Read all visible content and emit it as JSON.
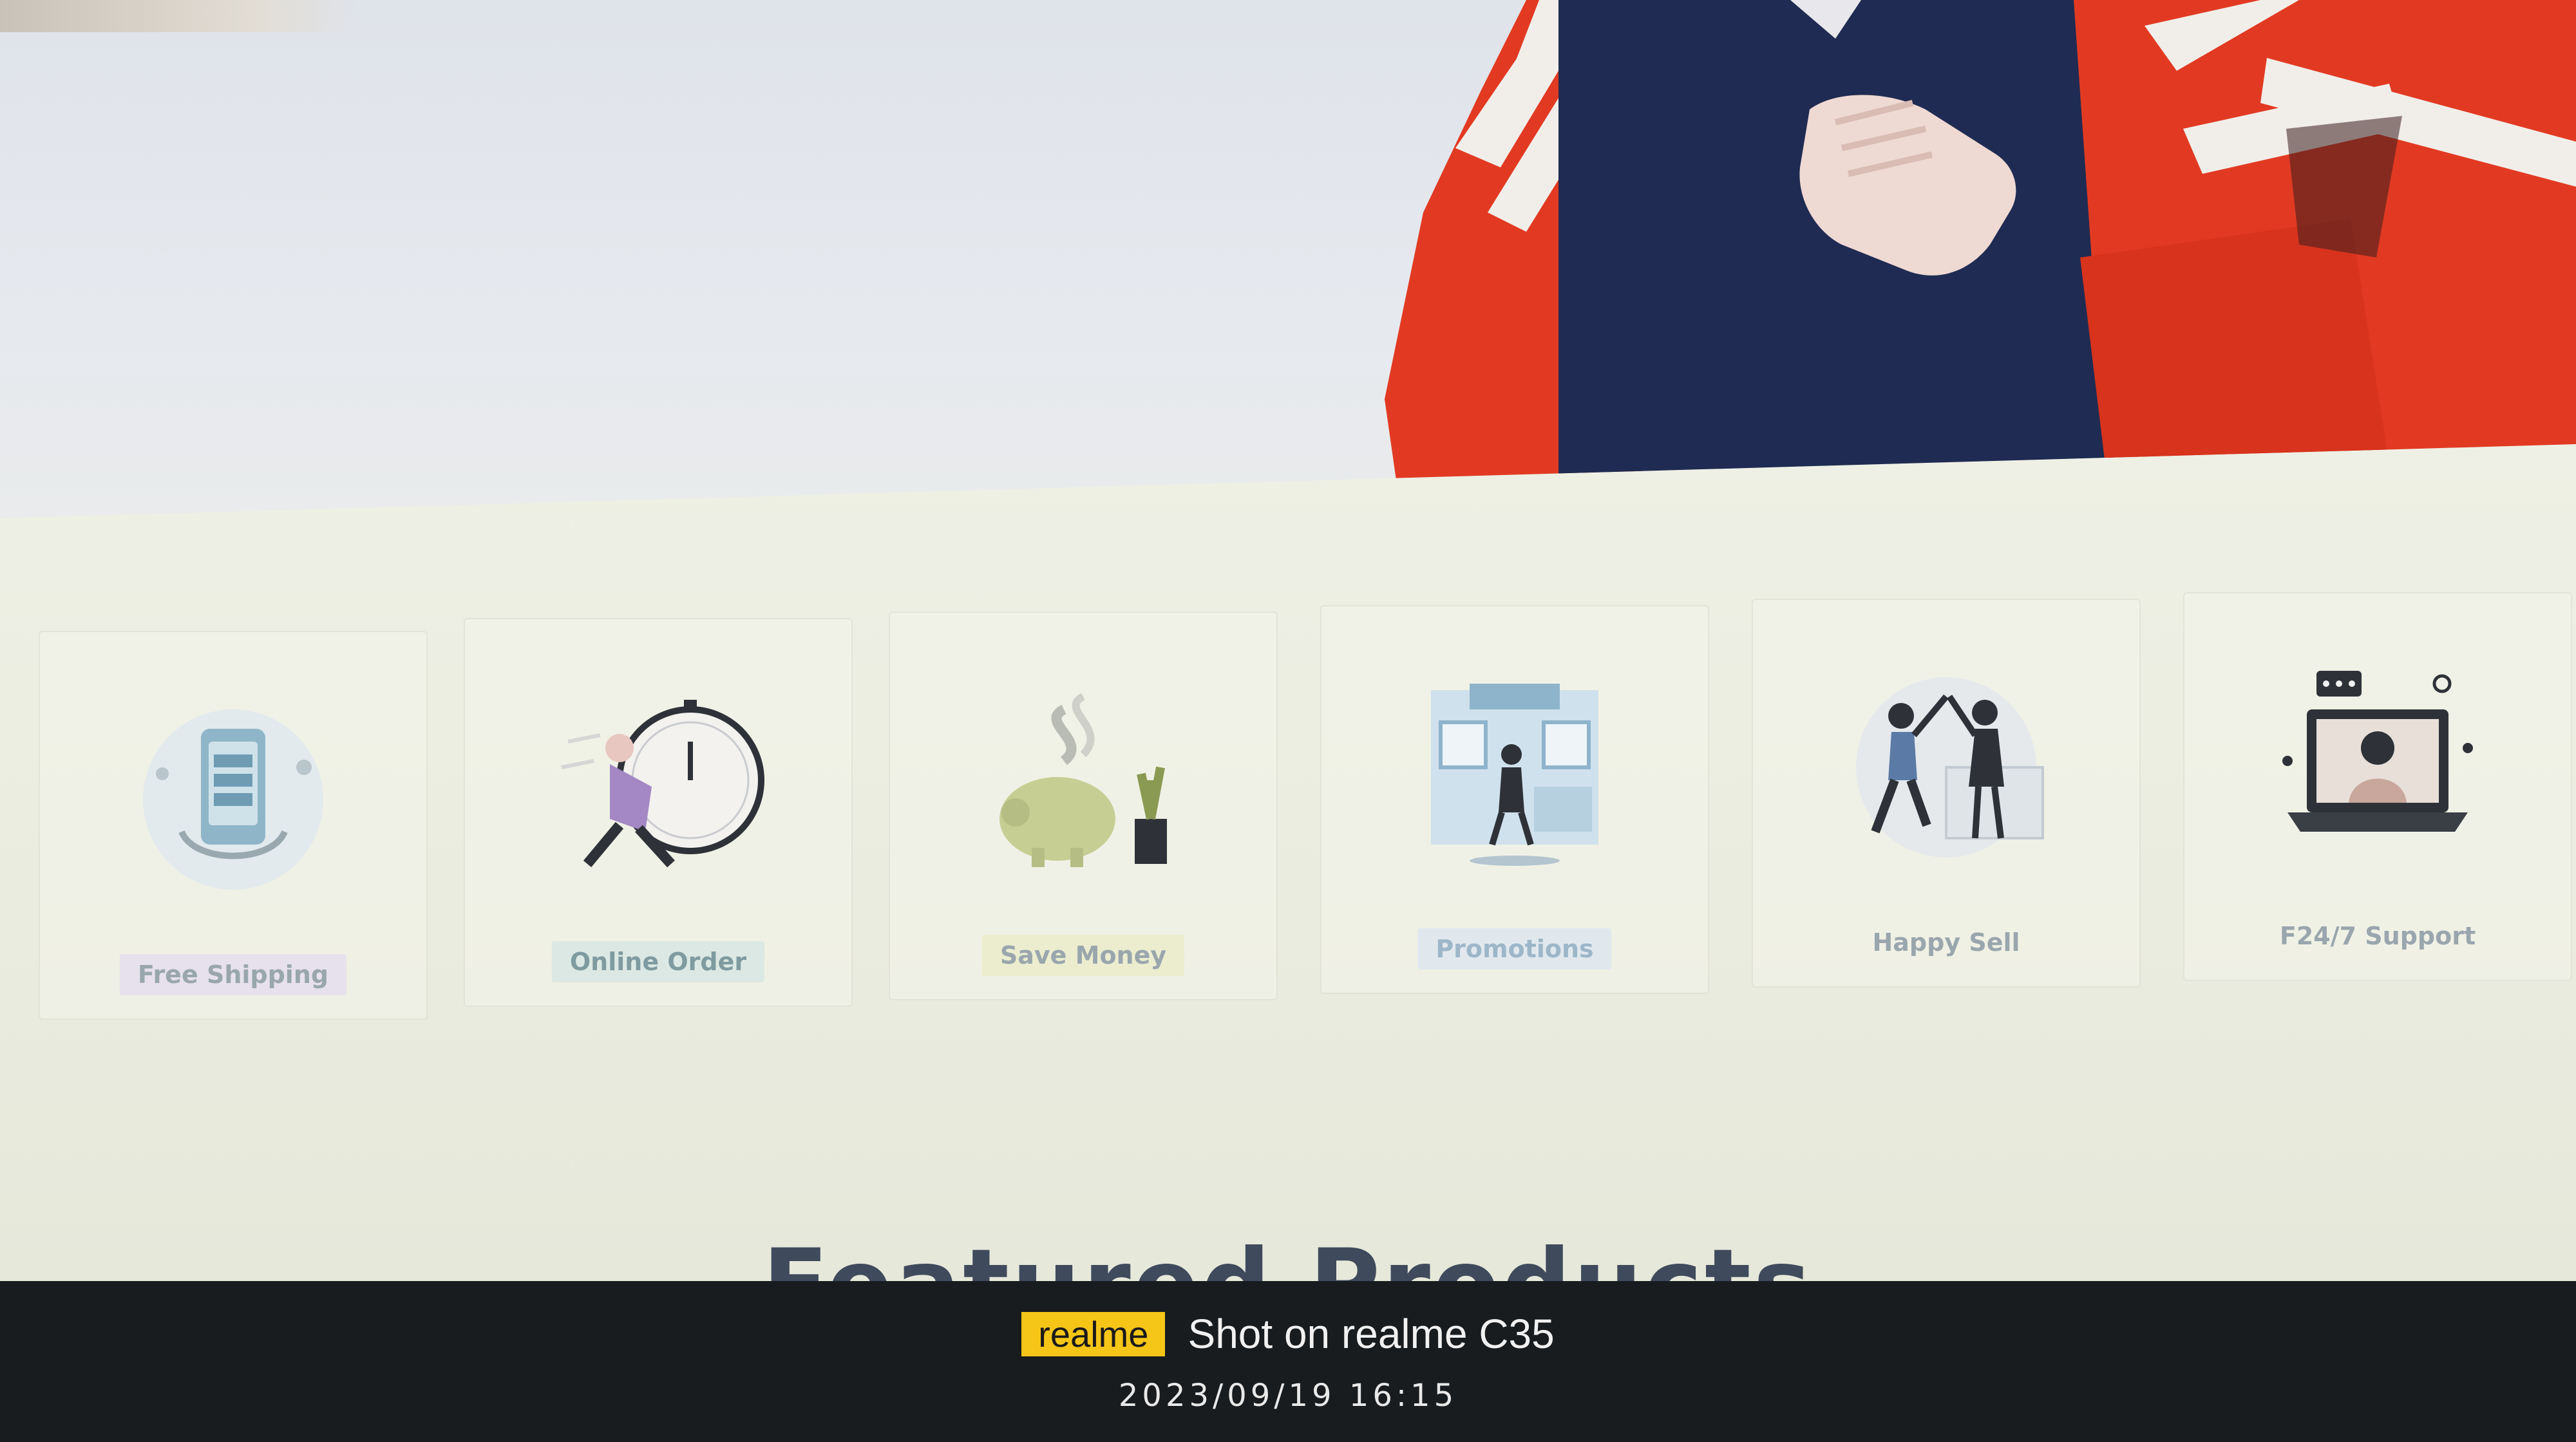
{
  "features": [
    {
      "label": "Free Shipping",
      "icon": "phone-shopping-icon"
    },
    {
      "label": "Online Order",
      "icon": "runner-clock-icon"
    },
    {
      "label": "Save Money",
      "icon": "piggy-bank-icon"
    },
    {
      "label": "Promotions",
      "icon": "storefront-icon"
    },
    {
      "label": "Happy Sell",
      "icon": "high-five-icon"
    },
    {
      "label": "F24/7 Support",
      "icon": "laptop-support-icon"
    }
  ],
  "featured": {
    "title": "Featured Products"
  },
  "watermark": {
    "brand": "realme",
    "caption": "Shot on realme C35",
    "datetime": "2023/09/19  16:15"
  },
  "colors": {
    "title": "#3f4a5c",
    "brand_badge": "#f5c518",
    "jacket_red": "#e23a22",
    "shirt_navy": "#1f2b52"
  }
}
